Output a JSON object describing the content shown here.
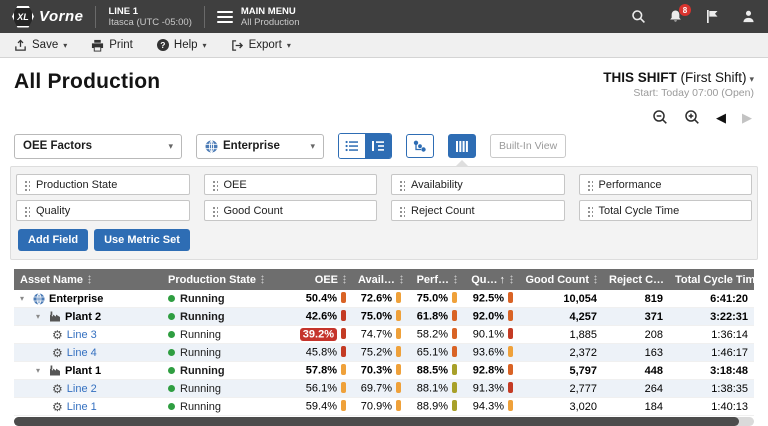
{
  "topbar": {
    "brand_badge": "XL",
    "brand": "Vorne",
    "line": {
      "name": "LINE 1",
      "location": "Itasca (UTC -05:00)"
    },
    "menu": {
      "title": "MAIN MENU",
      "subtitle": "All Production"
    },
    "notification_count": "8"
  },
  "toolbar": {
    "save": "Save",
    "print": "Print",
    "help": "Help",
    "export": "Export"
  },
  "page": {
    "title": "All Production",
    "shift_label": "THIS SHIFT",
    "shift_detail": " (First Shift)",
    "shift_start": "Start: Today 07:00 (Open)"
  },
  "controls": {
    "metric_select": "OEE Factors",
    "asset_select": "Enterprise",
    "built_in_view": "Built-In View"
  },
  "fields": {
    "chips": [
      "Production State",
      "OEE",
      "Availability",
      "Performance",
      "Quality",
      "Good Count",
      "Reject Count",
      "Total Cycle Time"
    ],
    "add_field": "Add Field",
    "use_metric_set": "Use Metric Set"
  },
  "table": {
    "columns": [
      {
        "label": "Asset Name",
        "align": "left"
      },
      {
        "label": "Production State",
        "align": "left"
      },
      {
        "label": "OEE",
        "align": "right"
      },
      {
        "label": "Avail…",
        "align": "right"
      },
      {
        "label": "Perf…",
        "align": "right"
      },
      {
        "label": "Qu…",
        "align": "right",
        "sort": "asc"
      },
      {
        "label": "Good Count",
        "align": "right"
      },
      {
        "label": "Reject C…",
        "align": "right"
      },
      {
        "label": "Total Cycle Time",
        "align": "right"
      }
    ],
    "rows": [
      {
        "name": "Enterprise",
        "level": 0,
        "icon": "globe",
        "bold": true,
        "expanded": true,
        "link": false,
        "state": "Running",
        "metrics": [
          {
            "v": "50.4%",
            "c": "orange_red"
          },
          {
            "v": "72.6%",
            "c": "orange"
          },
          {
            "v": "75.0%",
            "c": "orange"
          },
          {
            "v": "92.5%",
            "c": "orange_red"
          }
        ],
        "good": "10,054",
        "reject": "819",
        "cycle": "6:41:20"
      },
      {
        "name": "Plant 2",
        "level": 1,
        "icon": "factory",
        "bold": true,
        "expanded": true,
        "link": false,
        "state": "Running",
        "metrics": [
          {
            "v": "42.6%",
            "c": "red"
          },
          {
            "v": "75.0%",
            "c": "orange"
          },
          {
            "v": "61.8%",
            "c": "orange_red"
          },
          {
            "v": "92.0%",
            "c": "orange_red"
          }
        ],
        "good": "4,257",
        "reject": "371",
        "cycle": "3:22:31"
      },
      {
        "name": "Line 3",
        "level": 2,
        "icon": "gear",
        "bold": false,
        "expanded": false,
        "link": true,
        "state": "Running",
        "metrics": [
          {
            "v": "39.2%",
            "c": "red",
            "badge": true
          },
          {
            "v": "74.7%",
            "c": "orange"
          },
          {
            "v": "58.2%",
            "c": "orange_red"
          },
          {
            "v": "90.1%",
            "c": "red"
          }
        ],
        "good": "1,885",
        "reject": "208",
        "cycle": "1:36:14"
      },
      {
        "name": "Line 4",
        "level": 2,
        "icon": "gear",
        "bold": false,
        "expanded": false,
        "link": true,
        "state": "Running",
        "metrics": [
          {
            "v": "45.8%",
            "c": "red"
          },
          {
            "v": "75.2%",
            "c": "orange"
          },
          {
            "v": "65.1%",
            "c": "orange_red"
          },
          {
            "v": "93.6%",
            "c": "orange"
          }
        ],
        "good": "2,372",
        "reject": "163",
        "cycle": "1:46:17"
      },
      {
        "name": "Plant 1",
        "level": 1,
        "icon": "factory",
        "bold": true,
        "expanded": true,
        "link": false,
        "state": "Running",
        "metrics": [
          {
            "v": "57.8%",
            "c": "orange"
          },
          {
            "v": "70.3%",
            "c": "orange"
          },
          {
            "v": "88.5%",
            "c": "olive"
          },
          {
            "v": "92.8%",
            "c": "orange_red"
          }
        ],
        "good": "5,797",
        "reject": "448",
        "cycle": "3:18:48"
      },
      {
        "name": "Line 2",
        "level": 2,
        "icon": "gear",
        "bold": false,
        "expanded": false,
        "link": true,
        "state": "Running",
        "metrics": [
          {
            "v": "56.1%",
            "c": "orange"
          },
          {
            "v": "69.7%",
            "c": "orange"
          },
          {
            "v": "88.1%",
            "c": "olive"
          },
          {
            "v": "91.3%",
            "c": "red"
          }
        ],
        "good": "2,777",
        "reject": "264",
        "cycle": "1:38:35"
      },
      {
        "name": "Line 1",
        "level": 2,
        "icon": "gear",
        "bold": false,
        "expanded": false,
        "link": true,
        "state": "Running",
        "metrics": [
          {
            "v": "59.4%",
            "c": "orange"
          },
          {
            "v": "70.9%",
            "c": "orange"
          },
          {
            "v": "88.9%",
            "c": "olive"
          },
          {
            "v": "94.3%",
            "c": "orange"
          }
        ],
        "good": "3,020",
        "reject": "184",
        "cycle": "1:40:13"
      }
    ]
  },
  "colors": {
    "accent_blue": "#2e6db4",
    "link_blue": "#3470c0",
    "running_green": "#2f9e41",
    "badge_red": "#c5342b",
    "row_stripe": "#edf2f8",
    "bars": {
      "red": "#c43b24",
      "orange_red": "#d96325",
      "orange": "#efa13a",
      "olive": "#a8a029"
    }
  }
}
